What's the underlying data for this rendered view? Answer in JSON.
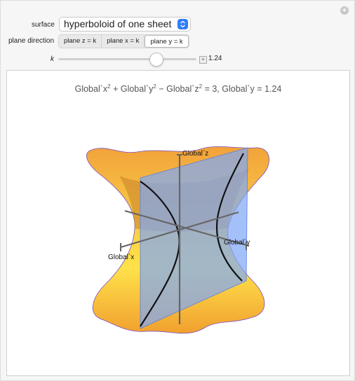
{
  "controls": {
    "surface_label": "surface",
    "surface_value": "hyperboloid of one sheet",
    "plane_direction_label": "plane direction",
    "plane_options": [
      "plane z = k",
      "plane x = k",
      "plane y = k"
    ],
    "plane_selected": 2,
    "k_label": "k",
    "k_value": 1.24,
    "k_display": "1.24"
  },
  "plot": {
    "equation_prefix": "Global`x",
    "equation_plus": " + Global`y",
    "equation_minus": " − Global`z",
    "equation_rhs": " = 3, Global`y = 1.24",
    "exp": "2",
    "axis_z_label": "Global`z",
    "axis_y_label": "Global`y",
    "axis_x_label": "Global`x"
  },
  "colors": {
    "surface_top": "#f7a83a",
    "surface_mid": "#ffe24a",
    "plane": "#7fa7f5",
    "accent": "#2f7df6"
  }
}
